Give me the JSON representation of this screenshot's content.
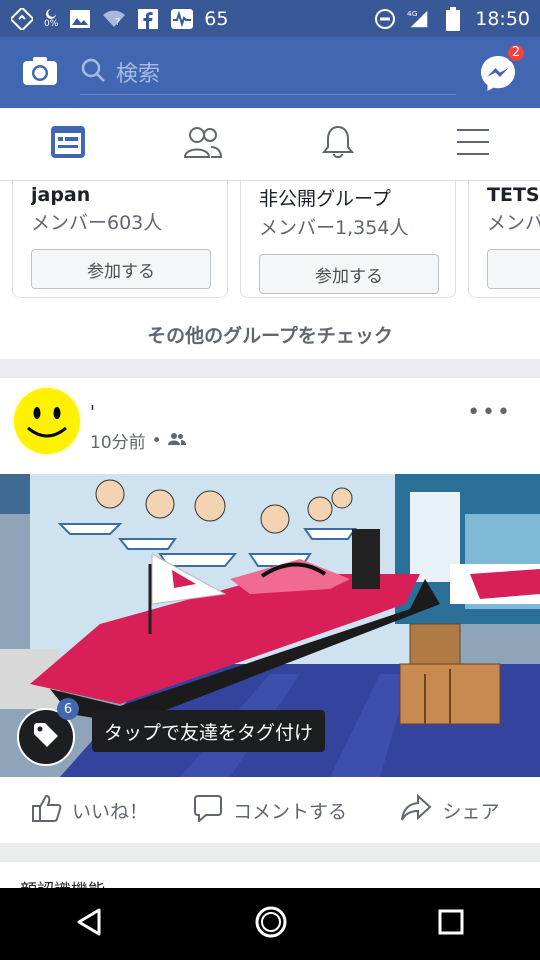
{
  "status_bar": {
    "battery_saver": "0%",
    "signal_value": "65",
    "network": "4G",
    "time": "18:50"
  },
  "header": {
    "search_placeholder": "検索",
    "messenger_badge": "2"
  },
  "tabs": [
    "news-feed",
    "friends",
    "notifications",
    "menu"
  ],
  "groups": [
    {
      "name": "japan",
      "members": "メンバー603人",
      "join_label": "参加する"
    },
    {
      "name": "非公開グループ",
      "members": "メンバー1,354人",
      "join_label": "参加する"
    },
    {
      "name": "TETSU",
      "members": "メンバー",
      "join_label": ""
    }
  ],
  "more_groups_label": "その他のグループをチェック",
  "post": {
    "author": "'",
    "time": "10分前",
    "more": "•••",
    "tag_count": "6",
    "tag_tip": "タップで友達をタグ付け",
    "actions": {
      "like": "いいね！",
      "comment": "コメントする",
      "share": "シェア"
    }
  },
  "next_post_text": "顔認識機能",
  "colors": {
    "header": "#4267b2",
    "status_bar": "#385898",
    "badge": "#fa3e3e"
  }
}
